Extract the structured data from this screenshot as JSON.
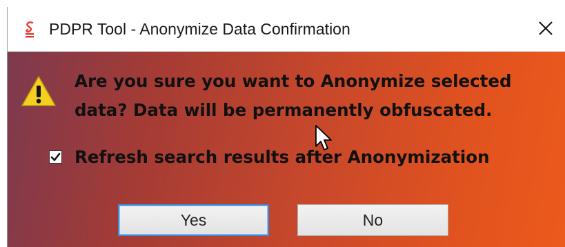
{
  "window": {
    "title": "PDPR Tool - Anonymize Data Confirmation",
    "icon": "app-logo-icon",
    "close_icon": "close-icon"
  },
  "dialog": {
    "icon": "warning-icon",
    "message": "Are you sure you want to Anonymize selected\ndata? Data will be permanently obfuscated.",
    "checkbox": {
      "label": "Refresh search results after Anonymization",
      "checked": true
    },
    "buttons": {
      "yes_label": "Yes",
      "no_label": "No"
    }
  },
  "colors": {
    "accent_focus": "#3c8ad8",
    "warning_yellow": "#f5d020",
    "background_gradient_start": "#7d3a4e",
    "background_gradient_end": "#ec5a1c"
  }
}
